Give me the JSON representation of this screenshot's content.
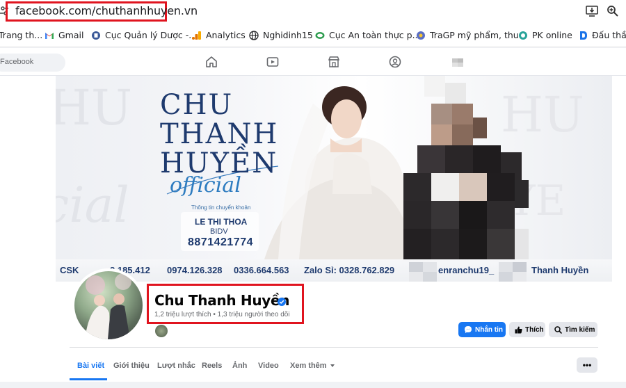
{
  "browser": {
    "url": "facebook.com/chuthanhhuyen.vn"
  },
  "bookmarks": [
    {
      "label": "Trang th...",
      "icon": "page-icon",
      "color": "#5f6368"
    },
    {
      "label": "Gmail",
      "icon": "gmail-icon",
      "color": "#ea4335"
    },
    {
      "label": "Cục Quản lý Dược -...",
      "icon": "site-icon",
      "color": "#3b5998"
    },
    {
      "label": "Analytics",
      "icon": "analytics-icon",
      "color": "#f9ab00"
    },
    {
      "label": "Nghidinh15",
      "icon": "globe-icon",
      "color": "#202124"
    },
    {
      "label": "Cục An toàn thực p...",
      "icon": "site-icon",
      "color": "#2e9d4f"
    },
    {
      "label": "TraGP mỹ phẩm, thu...",
      "icon": "site-icon",
      "color": "#5b6fc4"
    },
    {
      "label": "PK online",
      "icon": "site-icon",
      "color": "#2aa39a"
    },
    {
      "label": "Đấu thầu",
      "icon": "site-icon",
      "color": "#1a73e8"
    }
  ],
  "facebook": {
    "search_placeholder": "Facebook",
    "nav_icons": [
      "home-icon",
      "video-icon",
      "marketplace-icon",
      "groups-icon"
    ]
  },
  "cover": {
    "title_line1": "CHU",
    "title_line2": "THANH",
    "title_line3": "HUYỀN",
    "official": "official",
    "bank_label": "Thông tin chuyển khoản",
    "bank_holder": "LE THI THOA",
    "bank_name": "BIDV",
    "bank_account": "8871421774",
    "contacts": [
      "CSK",
      "2.185.412",
      "0974.126.328",
      "0336.664.563",
      "Zalo Sỉ: 0328.762.829",
      "enranchu19_",
      "Thanh Huyền"
    ]
  },
  "profile": {
    "name": "Chu Thanh Huyền",
    "stats": "1,2 triệu lượt thích • 1,3 triệu người theo dõi"
  },
  "actions": {
    "message": "Nhắn tin",
    "like": "Thích",
    "search": "Tìm kiếm"
  },
  "tabs": [
    "Bài viết",
    "Giới thiệu",
    "Lượt nhắc",
    "Reels",
    "Ảnh",
    "Video",
    "Xem thêm"
  ],
  "more_button": "•••",
  "colors": {
    "brand": "#1877f2",
    "highlight": "#e0141f",
    "cover_text": "#1e3a6e"
  }
}
